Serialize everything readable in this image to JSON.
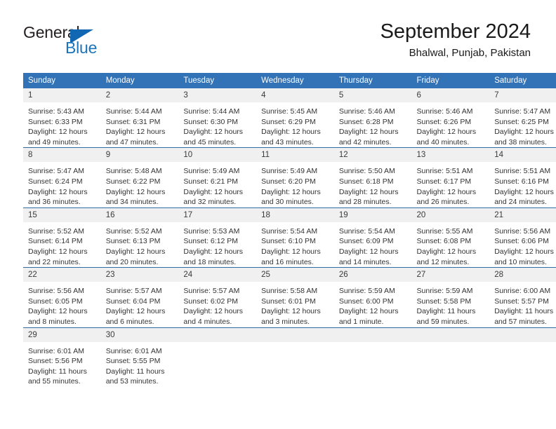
{
  "brand": {
    "name_dark": "General",
    "name_blue": "Blue",
    "accent_color": "#1b75bb",
    "header_color": "#3272b6"
  },
  "header": {
    "title": "September 2024",
    "subtitle": "Bhalwal, Punjab, Pakistan"
  },
  "weekday_headers": [
    "Sunday",
    "Monday",
    "Tuesday",
    "Wednesday",
    "Thursday",
    "Friday",
    "Saturday"
  ],
  "labels": {
    "sunrise_prefix": "Sunrise:",
    "sunset_prefix": "Sunset:",
    "daylight_prefix": "Daylight:"
  },
  "weeks": [
    [
      {
        "day": "1",
        "sunrise": "Sunrise: 5:43 AM",
        "sunset": "Sunset: 6:33 PM",
        "daylight": "Daylight: 12 hours and 49 minutes."
      },
      {
        "day": "2",
        "sunrise": "Sunrise: 5:44 AM",
        "sunset": "Sunset: 6:31 PM",
        "daylight": "Daylight: 12 hours and 47 minutes."
      },
      {
        "day": "3",
        "sunrise": "Sunrise: 5:44 AM",
        "sunset": "Sunset: 6:30 PM",
        "daylight": "Daylight: 12 hours and 45 minutes."
      },
      {
        "day": "4",
        "sunrise": "Sunrise: 5:45 AM",
        "sunset": "Sunset: 6:29 PM",
        "daylight": "Daylight: 12 hours and 43 minutes."
      },
      {
        "day": "5",
        "sunrise": "Sunrise: 5:46 AM",
        "sunset": "Sunset: 6:28 PM",
        "daylight": "Daylight: 12 hours and 42 minutes."
      },
      {
        "day": "6",
        "sunrise": "Sunrise: 5:46 AM",
        "sunset": "Sunset: 6:26 PM",
        "daylight": "Daylight: 12 hours and 40 minutes."
      },
      {
        "day": "7",
        "sunrise": "Sunrise: 5:47 AM",
        "sunset": "Sunset: 6:25 PM",
        "daylight": "Daylight: 12 hours and 38 minutes."
      }
    ],
    [
      {
        "day": "8",
        "sunrise": "Sunrise: 5:47 AM",
        "sunset": "Sunset: 6:24 PM",
        "daylight": "Daylight: 12 hours and 36 minutes."
      },
      {
        "day": "9",
        "sunrise": "Sunrise: 5:48 AM",
        "sunset": "Sunset: 6:22 PM",
        "daylight": "Daylight: 12 hours and 34 minutes."
      },
      {
        "day": "10",
        "sunrise": "Sunrise: 5:49 AM",
        "sunset": "Sunset: 6:21 PM",
        "daylight": "Daylight: 12 hours and 32 minutes."
      },
      {
        "day": "11",
        "sunrise": "Sunrise: 5:49 AM",
        "sunset": "Sunset: 6:20 PM",
        "daylight": "Daylight: 12 hours and 30 minutes."
      },
      {
        "day": "12",
        "sunrise": "Sunrise: 5:50 AM",
        "sunset": "Sunset: 6:18 PM",
        "daylight": "Daylight: 12 hours and 28 minutes."
      },
      {
        "day": "13",
        "sunrise": "Sunrise: 5:51 AM",
        "sunset": "Sunset: 6:17 PM",
        "daylight": "Daylight: 12 hours and 26 minutes."
      },
      {
        "day": "14",
        "sunrise": "Sunrise: 5:51 AM",
        "sunset": "Sunset: 6:16 PM",
        "daylight": "Daylight: 12 hours and 24 minutes."
      }
    ],
    [
      {
        "day": "15",
        "sunrise": "Sunrise: 5:52 AM",
        "sunset": "Sunset: 6:14 PM",
        "daylight": "Daylight: 12 hours and 22 minutes."
      },
      {
        "day": "16",
        "sunrise": "Sunrise: 5:52 AM",
        "sunset": "Sunset: 6:13 PM",
        "daylight": "Daylight: 12 hours and 20 minutes."
      },
      {
        "day": "17",
        "sunrise": "Sunrise: 5:53 AM",
        "sunset": "Sunset: 6:12 PM",
        "daylight": "Daylight: 12 hours and 18 minutes."
      },
      {
        "day": "18",
        "sunrise": "Sunrise: 5:54 AM",
        "sunset": "Sunset: 6:10 PM",
        "daylight": "Daylight: 12 hours and 16 minutes."
      },
      {
        "day": "19",
        "sunrise": "Sunrise: 5:54 AM",
        "sunset": "Sunset: 6:09 PM",
        "daylight": "Daylight: 12 hours and 14 minutes."
      },
      {
        "day": "20",
        "sunrise": "Sunrise: 5:55 AM",
        "sunset": "Sunset: 6:08 PM",
        "daylight": "Daylight: 12 hours and 12 minutes."
      },
      {
        "day": "21",
        "sunrise": "Sunrise: 5:56 AM",
        "sunset": "Sunset: 6:06 PM",
        "daylight": "Daylight: 12 hours and 10 minutes."
      }
    ],
    [
      {
        "day": "22",
        "sunrise": "Sunrise: 5:56 AM",
        "sunset": "Sunset: 6:05 PM",
        "daylight": "Daylight: 12 hours and 8 minutes."
      },
      {
        "day": "23",
        "sunrise": "Sunrise: 5:57 AM",
        "sunset": "Sunset: 6:04 PM",
        "daylight": "Daylight: 12 hours and 6 minutes."
      },
      {
        "day": "24",
        "sunrise": "Sunrise: 5:57 AM",
        "sunset": "Sunset: 6:02 PM",
        "daylight": "Daylight: 12 hours and 4 minutes."
      },
      {
        "day": "25",
        "sunrise": "Sunrise: 5:58 AM",
        "sunset": "Sunset: 6:01 PM",
        "daylight": "Daylight: 12 hours and 3 minutes."
      },
      {
        "day": "26",
        "sunrise": "Sunrise: 5:59 AM",
        "sunset": "Sunset: 6:00 PM",
        "daylight": "Daylight: 12 hours and 1 minute."
      },
      {
        "day": "27",
        "sunrise": "Sunrise: 5:59 AM",
        "sunset": "Sunset: 5:58 PM",
        "daylight": "Daylight: 11 hours and 59 minutes."
      },
      {
        "day": "28",
        "sunrise": "Sunrise: 6:00 AM",
        "sunset": "Sunset: 5:57 PM",
        "daylight": "Daylight: 11 hours and 57 minutes."
      }
    ],
    [
      {
        "day": "29",
        "sunrise": "Sunrise: 6:01 AM",
        "sunset": "Sunset: 5:56 PM",
        "daylight": "Daylight: 11 hours and 55 minutes."
      },
      {
        "day": "30",
        "sunrise": "Sunrise: 6:01 AM",
        "sunset": "Sunset: 5:55 PM",
        "daylight": "Daylight: 11 hours and 53 minutes."
      },
      {
        "day": "",
        "sunrise": "",
        "sunset": "",
        "daylight": ""
      },
      {
        "day": "",
        "sunrise": "",
        "sunset": "",
        "daylight": ""
      },
      {
        "day": "",
        "sunrise": "",
        "sunset": "",
        "daylight": ""
      },
      {
        "day": "",
        "sunrise": "",
        "sunset": "",
        "daylight": ""
      },
      {
        "day": "",
        "sunrise": "",
        "sunset": "",
        "daylight": ""
      }
    ]
  ]
}
